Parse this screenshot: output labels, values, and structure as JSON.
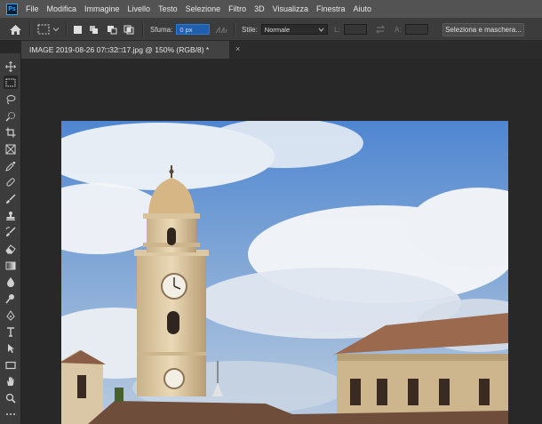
{
  "app": {
    "logo": "Ps"
  },
  "menu": [
    "File",
    "Modifica",
    "Immagine",
    "Livello",
    "Testo",
    "Selezione",
    "Filtro",
    "3D",
    "Visualizza",
    "Finestra",
    "Aiuto"
  ],
  "options": {
    "feather_label": "Sfuma:",
    "feather_value": "0 px",
    "style_label": "Stile:",
    "style_value": "Normale",
    "width_label": "L:",
    "height_label": "A:",
    "select_mask_button": "Seleziona e maschera..."
  },
  "document": {
    "tab_title": "IMAGE 2019-08-26 07□32□17.jpg @ 150% (RGB/8) *",
    "close_glyph": "×"
  },
  "tools": [
    "move-tool",
    "rectangular-marquee-tool",
    "lasso-tool",
    "quick-selection-tool",
    "crop-tool",
    "frame-tool",
    "eyedropper-tool",
    "healing-brush-tool",
    "brush-tool",
    "clone-stamp-tool",
    "history-brush-tool",
    "eraser-tool",
    "gradient-tool",
    "blur-tool",
    "dodge-tool",
    "pen-tool",
    "type-tool",
    "path-selection-tool",
    "rectangle-tool",
    "hand-tool",
    "zoom-tool",
    "more-tools"
  ],
  "colors": {
    "menubar": "#535353",
    "optionsbar": "#3c3c3c",
    "workspace": "#282828",
    "accent": "#31a8ff"
  }
}
